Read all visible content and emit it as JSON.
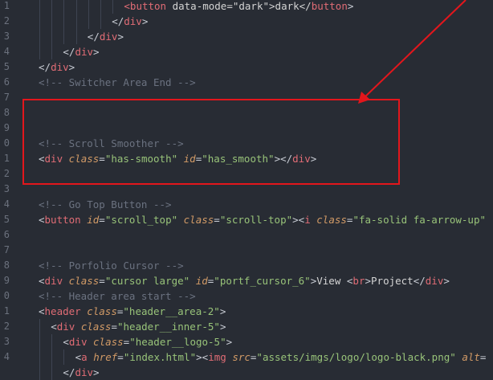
{
  "editor": {
    "line_numbers": [
      "1",
      "2",
      "3",
      "4",
      "5",
      "6",
      "7",
      "8",
      "9",
      "0",
      "1",
      "2",
      "3",
      "4",
      "5",
      "6",
      "7",
      "8",
      "9",
      "0",
      "1",
      "2",
      "3",
      "4"
    ],
    "lines": [
      {
        "indent": 7,
        "tokens": [
          [
            "tag",
            "<button"
          ],
          [
            "txt",
            " data-mode=\"dark\">dark</"
          ],
          [
            "tag",
            "button"
          ],
          [
            "pun",
            ">"
          ]
        ]
      },
      {
        "indent": 6,
        "tokens": [
          [
            "pun",
            "</"
          ],
          [
            "tag",
            "div"
          ],
          [
            "pun",
            ">"
          ]
        ]
      },
      {
        "indent": 4,
        "tokens": [
          [
            "pun",
            "</"
          ],
          [
            "tag",
            "div"
          ],
          [
            "pun",
            ">"
          ]
        ]
      },
      {
        "indent": 2,
        "tokens": [
          [
            "pun",
            "</"
          ],
          [
            "tag",
            "div"
          ],
          [
            "pun",
            ">"
          ]
        ]
      },
      {
        "indent": 0,
        "tokens": [
          [
            "pun",
            "</"
          ],
          [
            "tag",
            "div"
          ],
          [
            "pun",
            ">"
          ]
        ]
      },
      {
        "indent": 0,
        "tokens": [
          [
            "cmt",
            "<!-- Switcher Area End -->"
          ]
        ]
      },
      {
        "indent": 0,
        "tokens": []
      },
      {
        "indent": 0,
        "tokens": []
      },
      {
        "indent": 0,
        "tokens": []
      },
      {
        "indent": 0,
        "tokens": [
          [
            "cmt",
            "<!-- Scroll Smoother -->"
          ]
        ]
      },
      {
        "indent": 0,
        "tokens": [
          [
            "pun",
            "<"
          ],
          [
            "tag",
            "div"
          ],
          [
            "txt",
            " "
          ],
          [
            "attr",
            "class"
          ],
          [
            "pun",
            "="
          ],
          [
            "str",
            "\"has-smooth\""
          ],
          [
            "txt",
            " "
          ],
          [
            "attr",
            "id"
          ],
          [
            "pun",
            "="
          ],
          [
            "str",
            "\"has_smooth\""
          ],
          [
            "pun",
            "></"
          ],
          [
            "tag",
            "div"
          ],
          [
            "pun",
            ">"
          ]
        ]
      },
      {
        "indent": 0,
        "tokens": []
      },
      {
        "indent": 0,
        "tokens": []
      },
      {
        "indent": 0,
        "tokens": [
          [
            "cmt",
            "<!-- Go Top Button -->"
          ]
        ]
      },
      {
        "indent": 0,
        "tokens": [
          [
            "pun",
            "<"
          ],
          [
            "tag",
            "button"
          ],
          [
            "txt",
            " "
          ],
          [
            "attr",
            "id"
          ],
          [
            "pun",
            "="
          ],
          [
            "str",
            "\"scroll_top\""
          ],
          [
            "txt",
            " "
          ],
          [
            "attr",
            "class"
          ],
          [
            "pun",
            "="
          ],
          [
            "str",
            "\"scroll-top\""
          ],
          [
            "pun",
            "><"
          ],
          [
            "tag",
            "i"
          ],
          [
            "txt",
            " "
          ],
          [
            "attr",
            "class"
          ],
          [
            "pun",
            "="
          ],
          [
            "str",
            "\"fa-solid fa-arrow-up\""
          ]
        ]
      },
      {
        "indent": 0,
        "tokens": []
      },
      {
        "indent": 0,
        "tokens": []
      },
      {
        "indent": 0,
        "tokens": [
          [
            "cmt",
            "<!-- Porfolio Cursor -->"
          ]
        ]
      },
      {
        "indent": 0,
        "tokens": [
          [
            "pun",
            "<"
          ],
          [
            "tag",
            "div"
          ],
          [
            "txt",
            " "
          ],
          [
            "attr",
            "class"
          ],
          [
            "pun",
            "="
          ],
          [
            "str",
            "\"cursor large\""
          ],
          [
            "txt",
            " "
          ],
          [
            "attr",
            "id"
          ],
          [
            "pun",
            "="
          ],
          [
            "str",
            "\"portf_cursor_6\""
          ],
          [
            "pun",
            ">"
          ],
          [
            "txt",
            "View "
          ],
          [
            "pun",
            "<"
          ],
          [
            "tag",
            "br"
          ],
          [
            "pun",
            ">"
          ],
          [
            "txt",
            "Project"
          ],
          [
            "pun",
            "</"
          ],
          [
            "tag",
            "div"
          ],
          [
            "pun",
            ">"
          ]
        ]
      },
      {
        "indent": 0,
        "tokens": [
          [
            "cmt",
            "<!-- Header area start -->"
          ]
        ]
      },
      {
        "indent": 0,
        "tokens": [
          [
            "pun",
            "<"
          ],
          [
            "tag",
            "header"
          ],
          [
            "txt",
            " "
          ],
          [
            "attr",
            "class"
          ],
          [
            "pun",
            "="
          ],
          [
            "str",
            "\"header__area-2\""
          ],
          [
            "pun",
            ">"
          ]
        ]
      },
      {
        "indent": 1,
        "tokens": [
          [
            "pun",
            "<"
          ],
          [
            "tag",
            "div"
          ],
          [
            "txt",
            " "
          ],
          [
            "attr",
            "class"
          ],
          [
            "pun",
            "="
          ],
          [
            "str",
            "\"header__inner-5\""
          ],
          [
            "pun",
            ">"
          ]
        ]
      },
      {
        "indent": 2,
        "tokens": [
          [
            "pun",
            "<"
          ],
          [
            "tag",
            "div"
          ],
          [
            "txt",
            " "
          ],
          [
            "attr",
            "class"
          ],
          [
            "pun",
            "="
          ],
          [
            "str",
            "\"header__logo-5\""
          ],
          [
            "pun",
            ">"
          ]
        ]
      },
      {
        "indent": 3,
        "tokens": [
          [
            "pun",
            "<"
          ],
          [
            "tag",
            "a"
          ],
          [
            "txt",
            " "
          ],
          [
            "attr",
            "href"
          ],
          [
            "pun",
            "="
          ],
          [
            "str",
            "\"index.html\""
          ],
          [
            "pun",
            "><"
          ],
          [
            "tag",
            "img"
          ],
          [
            "txt",
            " "
          ],
          [
            "attr",
            "src"
          ],
          [
            "pun",
            "="
          ],
          [
            "str",
            "\"assets/imgs/logo/logo-black.png\""
          ],
          [
            "txt",
            " "
          ],
          [
            "attr",
            "alt"
          ],
          [
            "pun",
            "="
          ]
        ]
      },
      {
        "indent": 2,
        "tokens": [
          [
            "pun",
            "</"
          ],
          [
            "tag",
            "div"
          ],
          [
            "pun",
            ">"
          ]
        ]
      }
    ]
  },
  "colors": {
    "highlight": "#e3161c",
    "background": "#282c34"
  }
}
